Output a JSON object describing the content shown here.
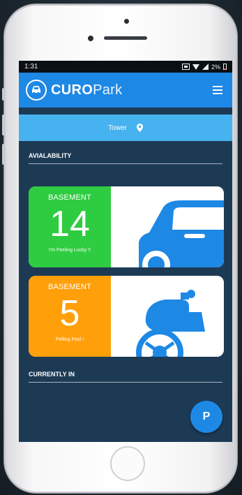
{
  "status_bar": {
    "time": "1:31",
    "battery": "2%"
  },
  "app_bar": {
    "brand_bold": "CURO",
    "brand_light": "Park"
  },
  "location": {
    "name": "Tower"
  },
  "availability": {
    "heading": "AVIALABILITY",
    "cards": [
      {
        "title": "BASEMENT",
        "count": "14",
        "subtitle": "I'm Feeling Lucky !!",
        "color": "#2ecc40",
        "vehicle": "car-icon"
      },
      {
        "title": "BASEMENT",
        "count": "5",
        "subtitle": "Felling Fool !",
        "color": "#ff9f0a",
        "vehicle": "motorbike-icon"
      }
    ]
  },
  "currently_in": {
    "heading": "CURRENTLY IN"
  },
  "fab": {
    "label": "P"
  },
  "colors": {
    "primary": "#1e88e5",
    "location_bar": "#47b2f0",
    "background": "#1d3a55",
    "icon_blue": "#1e88e5"
  }
}
